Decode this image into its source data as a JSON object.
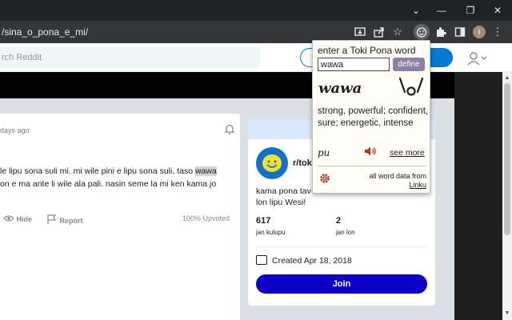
{
  "browser": {
    "url": "/sina_o_pona_e_mi/",
    "window_controls": {
      "tabs_chevron": "⌄",
      "minimize": "—",
      "maximize": "❐",
      "close": "✕"
    },
    "toolbar_icons": [
      "install-icon",
      "share-icon",
      "bookmark-star-icon",
      "toki-pona-extension-icon",
      "extensions-puzzle-icon",
      "side-panel-icon",
      "profile-avatar",
      "menu-dots-icon"
    ],
    "profile_initial": "I"
  },
  "reddit": {
    "search_placeholder": "rch Reddit",
    "post": {
      "time": "days ago",
      "text_lines": [
        {
          "before": "le lipu sona suli mi. mi wile pini e lipu sona suli, taso ",
          "highlight": "wawa",
          "after": ""
        },
        {
          "before": "on e ma ante li wile ala pali. nasin seme la mi ken kama jo",
          "highlight": "",
          "after": ""
        }
      ],
      "actions": {
        "hide": "Hide",
        "report": "Report",
        "upvoted": "100% Upvoted"
      }
    },
    "sidebar": {
      "community_name": "r/tok",
      "description": "kama pona tawa ... lon lipu Wesi!",
      "description_line1": "kama pona tav",
      "description_line2": "lon lipu Wesi!",
      "members_count": "617",
      "members_label": "jan kulupu",
      "online_count": "2",
      "online_label": "jan lon",
      "created": "Created Apr 18, 2018",
      "join_label": "Join"
    }
  },
  "popup": {
    "title": "enter a Toki Pona word",
    "input_value": "wawa",
    "define_label": "define",
    "word": "wawa",
    "definition": "strong, powerful; confident, sure; energetic, intense",
    "pronunciation": "pu",
    "see_more_label": "see more",
    "credit_text": "all word data from",
    "credit_link": "Linku"
  },
  "colors": {
    "join_button": "#0f00c9",
    "define_button": "#8d7fa6",
    "popup_accent": "#b0341f",
    "snoo_blue": "#0f72c7"
  }
}
